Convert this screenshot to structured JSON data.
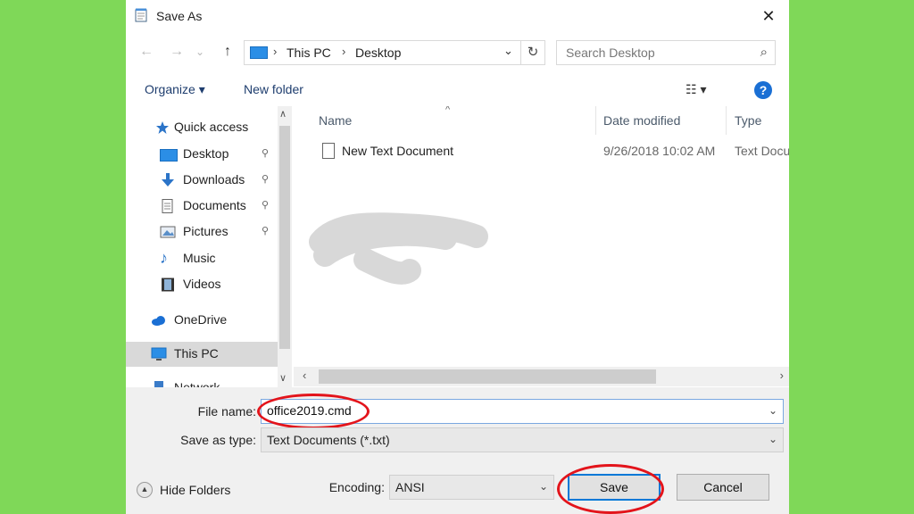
{
  "window": {
    "title": "Save As",
    "close_glyph": "✕"
  },
  "nav": {
    "back_glyph": "←",
    "forward_glyph": "→",
    "recent_glyph": "⌄",
    "up_glyph": "↑",
    "breadcrumbs": [
      "This PC",
      "Desktop"
    ],
    "search_placeholder": "Search Desktop"
  },
  "toolbar": {
    "organize": "Organize ▾",
    "new_folder": "New folder",
    "view_glyph": "☷ ▾",
    "help": "?"
  },
  "sidebar": {
    "items": [
      {
        "label": "Quick access",
        "icon": "star-icon",
        "pinned": false
      },
      {
        "label": "Desktop",
        "icon": "desktop-icon",
        "pinned": true
      },
      {
        "label": "Downloads",
        "icon": "download-icon",
        "pinned": true
      },
      {
        "label": "Documents",
        "icon": "documents-icon",
        "pinned": true
      },
      {
        "label": "Pictures",
        "icon": "pictures-icon",
        "pinned": true
      },
      {
        "label": "Music",
        "icon": "music-icon",
        "pinned": false
      },
      {
        "label": "Videos",
        "icon": "videos-icon",
        "pinned": false
      },
      {
        "label": "OneDrive",
        "icon": "cloud-icon",
        "pinned": false
      },
      {
        "label": "This PC",
        "icon": "computer-icon",
        "pinned": false,
        "selected": true
      },
      {
        "label": "Network",
        "icon": "network-icon",
        "pinned": false
      }
    ],
    "pin_glyph": "📌"
  },
  "files": {
    "columns": [
      "Name",
      "Date modified",
      "Type"
    ],
    "rows": [
      {
        "name": "New Text Document",
        "date": "9/26/2018 10:02 AM",
        "type": "Text Document"
      }
    ]
  },
  "form": {
    "filename_label": "File name:",
    "filename_value": "office2019.cmd",
    "type_label": "Save as type:",
    "type_value": "Text Documents (*.txt)",
    "encoding_label": "Encoding:",
    "encoding_value": "ANSI"
  },
  "footer": {
    "hide_folders": "Hide Folders",
    "save": "Save",
    "cancel": "Cancel"
  },
  "colors": {
    "background": "#7fd858",
    "highlight_ring": "#e3141b",
    "accent": "#0078d7"
  }
}
